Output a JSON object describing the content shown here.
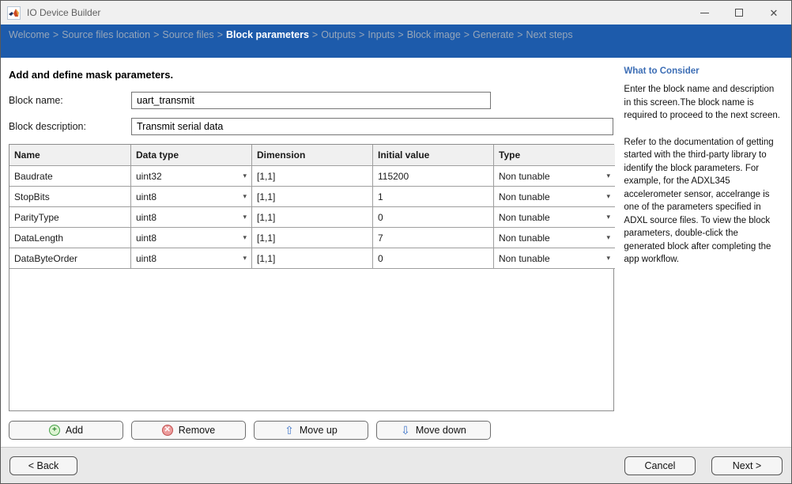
{
  "window": {
    "title": "IO Device Builder",
    "controls": {
      "minimize": "minimize",
      "maximize": "maximize",
      "close": "✕"
    }
  },
  "breadcrumb": {
    "separator": ">",
    "items": [
      {
        "label": "Welcome",
        "active": false
      },
      {
        "label": "Source files location",
        "active": false
      },
      {
        "label": "Source files",
        "active": false
      },
      {
        "label": "Block parameters",
        "active": true
      },
      {
        "label": "Outputs",
        "active": false
      },
      {
        "label": "Inputs",
        "active": false
      },
      {
        "label": "Block image",
        "active": false
      },
      {
        "label": "Generate",
        "active": false
      },
      {
        "label": "Next steps",
        "active": false
      }
    ]
  },
  "main": {
    "heading": "Add and define mask parameters.",
    "fields": {
      "block_name": {
        "label": "Block name:",
        "value": "uart_transmit"
      },
      "block_description": {
        "label": "Block description:",
        "value": "Transmit serial data"
      }
    },
    "table": {
      "columns": [
        "Name",
        "Data type",
        "Dimension",
        "Initial value",
        "Type"
      ],
      "dropdown_arrow": "▾",
      "rows": [
        {
          "name": "Baudrate",
          "data_type": "uint32",
          "dimension": "[1,1]",
          "initial_value": "115200",
          "type": "Non tunable"
        },
        {
          "name": "StopBits",
          "data_type": "uint8",
          "dimension": "[1,1]",
          "initial_value": "1",
          "type": "Non tunable"
        },
        {
          "name": "ParityType",
          "data_type": "uint8",
          "dimension": "[1,1]",
          "initial_value": "0",
          "type": "Non tunable"
        },
        {
          "name": "DataLength",
          "data_type": "uint8",
          "dimension": "[1,1]",
          "initial_value": "7",
          "type": "Non tunable"
        },
        {
          "name": "DataByteOrder",
          "data_type": "uint8",
          "dimension": "[1,1]",
          "initial_value": "0",
          "type": "Non tunable"
        }
      ]
    },
    "actions": {
      "add": "Add",
      "remove": "Remove",
      "move_up": "Move up",
      "move_down": "Move down",
      "add_icon_glyph": "+",
      "remove_icon_glyph": "✕",
      "up_arrow_glyph": "⇧",
      "down_arrow_glyph": "⇩"
    }
  },
  "sidebar": {
    "heading": "What to Consider",
    "paragraphs": [
      "Enter the block name and description in this screen.The block name is required to proceed to the next screen.",
      "Refer to the documentation of getting started with the third-party library to identify the block parameters. For example, for the ADXL345 accelerometer sensor, accelrange is one of the parameters specified in ADXL source files. To view the block parameters, double-click the generated block after completing the app workflow."
    ]
  },
  "footer": {
    "back": "< Back",
    "cancel": "Cancel",
    "next": "Next >"
  },
  "colors": {
    "nav_blue": "#1d5bab",
    "breadcrumb_inactive": "#97a6b9",
    "breadcrumb_active": "#ffffff",
    "sidebar_heading_blue": "#3d6eb5",
    "add_green": "#44a147",
    "remove_red": "#c05050",
    "move_arrow_blue": "#3e74c9",
    "titlebar_bg": "#f0f0f0",
    "footer_bg": "#e9e9e9",
    "table_header_bg": "#f0f0f0"
  }
}
